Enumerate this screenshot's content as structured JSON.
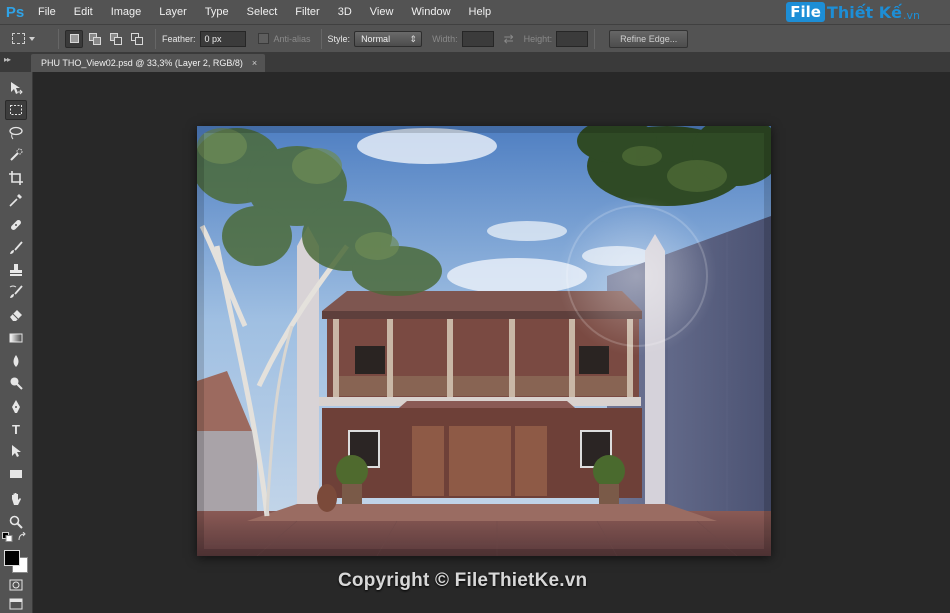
{
  "app": {
    "logo": "Ps",
    "menu": [
      "File",
      "Edit",
      "Image",
      "Layer",
      "Type",
      "Select",
      "Filter",
      "3D",
      "View",
      "Window",
      "Help"
    ]
  },
  "watermark": {
    "file": "File",
    "thietke": "Thiết Kế",
    "vn": ".vn"
  },
  "options": {
    "feather_label": "Feather:",
    "feather_value": "0 px",
    "antialias_label": "Anti-alias",
    "style_label": "Style:",
    "style_value": "Normal",
    "width_label": "Width:",
    "height_label": "Height:",
    "refine_label": "Refine Edge..."
  },
  "document": {
    "tab_title": "PHU THO_View02.psd @ 33,3% (Layer 2, RGB/8)",
    "close": "×"
  },
  "tools": [
    "move-icon",
    "rect-marquee-icon",
    "lasso-icon",
    "quick-select-icon",
    "crop-icon",
    "eyedropper-icon",
    "spot-heal-icon",
    "brush-icon",
    "clone-stamp-icon",
    "history-brush-icon",
    "eraser-icon",
    "gradient-icon",
    "blur-icon",
    "dodge-icon",
    "pen-icon",
    "type-icon",
    "path-select-icon",
    "rectangle-shape-icon",
    "hand-icon",
    "zoom-icon"
  ],
  "type_tool_glyph": "T",
  "copyright_text": "Copyright © FileThietKe.vn",
  "colors": {
    "accent": "#2fa3e7",
    "panel": "#535353",
    "workspace": "#282828",
    "foreground": "#000000",
    "background": "#ffffff"
  }
}
